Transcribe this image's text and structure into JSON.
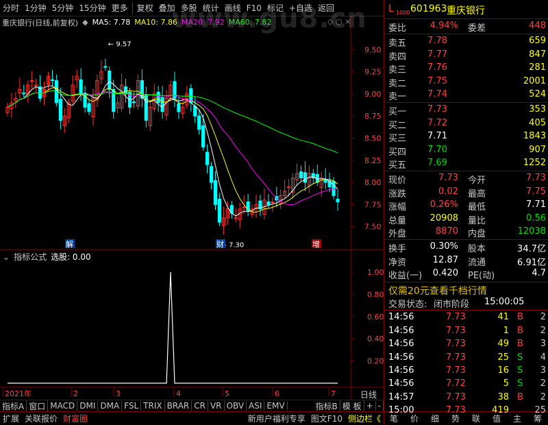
{
  "toolbar": {
    "items": [
      "分时",
      "1分钟",
      "5分钟",
      "15分钟",
      "更多",
      "复权",
      "叠加",
      "多股",
      "统计",
      "画线",
      "F10",
      "标记",
      "+自选",
      "返回"
    ]
  },
  "stock": {
    "prefix": "L",
    "prefix_sub": "1000",
    "code": "601963",
    "name": "重庆银行"
  },
  "chart_header": {
    "name": "重庆银行(日线,前复权)",
    "ma5": "MA5: 7.78",
    "ma10": "MA10: 7.86",
    "ma20": "MA20: 7.92",
    "ma60": "MA60: 7.82"
  },
  "watermark": "www.gu8.cn",
  "chart_data": [
    {
      "type": "candlestick",
      "title": "重庆银行(日线,前复权)",
      "y_ticks": [
        9.5,
        9.25,
        9.0,
        8.75,
        8.5,
        8.25,
        8.0,
        7.75,
        7.5
      ],
      "ylim": [
        7.28,
        9.72
      ],
      "annotations": {
        "high": "9.57",
        "low": "7.30"
      },
      "event_labels": [
        "解",
        "财",
        "增"
      ],
      "x_ticks": [
        "2021年",
        "2",
        "3",
        "4",
        "5",
        "6",
        "7"
      ],
      "series_closes": [
        8.85,
        8.9,
        8.95,
        9.05,
        9.0,
        9.1,
        9.15,
        9.1,
        8.95,
        9.05,
        9.2,
        9.15,
        8.9,
        8.7,
        8.75,
        8.9,
        9.1,
        9.2,
        9.0,
        8.85,
        8.8,
        8.95,
        9.15,
        9.25,
        9.3,
        9.05,
        8.8,
        8.9,
        9.1,
        9.0,
        8.85,
        8.9,
        9.15,
        8.95,
        8.7,
        8.85,
        9.0,
        8.9,
        8.8,
        8.95,
        9.1,
        8.95,
        8.8,
        8.85,
        9.0,
        8.9,
        8.75,
        8.6,
        8.4,
        8.2,
        8.0,
        7.75,
        7.55,
        7.6,
        7.7,
        7.65,
        7.6,
        7.7,
        7.72,
        7.68,
        7.7,
        7.75,
        7.7,
        7.8,
        7.75,
        7.78,
        7.8,
        7.85,
        7.9,
        7.95,
        8.05,
        8.1,
        8.05,
        8.0,
        8.1,
        8.05,
        8.0,
        8.05,
        8.0,
        7.95,
        7.85,
        7.78
      ]
    },
    {
      "type": "line",
      "title": "指标公式 选股: 0.00",
      "y_ticks": [
        1.0,
        0.8,
        0.6,
        0.4,
        0.2
      ],
      "ylim": [
        0,
        1.08
      ],
      "spike_index": 40,
      "spike_value": 1.0
    }
  ],
  "indicator_panel": {
    "label": "指标公式",
    "value": "选股: 0.00",
    "axis_label": "日线"
  },
  "indicator_tabs": [
    "指标A",
    "窗口",
    "MACD",
    "DMI",
    "DMA",
    "FSL",
    "TRIX",
    "BRAR",
    "CR",
    "VR",
    "OBV",
    "ASI",
    "EMV"
  ],
  "indicator_tabs_right": [
    "指标B",
    "模 板",
    "+",
    "-"
  ],
  "bottom_bar": {
    "left": [
      "扩展",
      "关联报价",
      "财富圈"
    ],
    "right": [
      "新用户福利专享",
      "图文F10",
      "侧边栏《"
    ],
    "tabs": [
      "笔",
      "价",
      "细",
      "势",
      "联",
      "值",
      "主",
      "筹"
    ]
  },
  "quote": {
    "weibi_label": "委比",
    "weibi": "4.94%",
    "weicha_label": "委差",
    "weicha": "448",
    "sells": [
      {
        "label": "卖五",
        "price": "7.78",
        "vol": "659"
      },
      {
        "label": "卖四",
        "price": "7.77",
        "vol": "847"
      },
      {
        "label": "卖三",
        "price": "7.76",
        "vol": "281"
      },
      {
        "label": "卖二",
        "price": "7.75",
        "vol": "2001"
      },
      {
        "label": "卖一",
        "price": "7.74",
        "vol": "524"
      }
    ],
    "buys": [
      {
        "label": "买一",
        "price": "7.73",
        "vol": "353"
      },
      {
        "label": "买二",
        "price": "7.72",
        "vol": "405"
      },
      {
        "label": "买三",
        "price": "7.71",
        "vol": "1843"
      },
      {
        "label": "买四",
        "price": "7.70",
        "vol": "907"
      },
      {
        "label": "买五",
        "price": "7.69",
        "vol": "1252"
      }
    ],
    "stats": [
      {
        "l1": "现价",
        "v1": "7.73",
        "l2": "今开",
        "v2": "7.73"
      },
      {
        "l1": "涨跌",
        "v1": "0.02",
        "l2": "最高",
        "v2": "7.75"
      },
      {
        "l1": "涨幅",
        "v1": "0.26%",
        "l2": "最低",
        "v2": "7.71"
      },
      {
        "l1": "总量",
        "v1": "20908",
        "l2": "量比",
        "v2": "0.56"
      },
      {
        "l1": "外盘",
        "v1": "8870",
        "l2": "内盘",
        "v2": "12038"
      }
    ],
    "fund": [
      {
        "l1": "换手",
        "v1": "0.30%",
        "l2": "股本",
        "v2": "34.7亿"
      },
      {
        "l1": "净资",
        "v1": "12.87",
        "l2": "流通",
        "v2": "6.91亿"
      },
      {
        "l1": "收益(一)",
        "v1": "0.420",
        "l2": "PE(动)",
        "v2": "4.7"
      }
    ],
    "promo": "仅需20元查看千档行情",
    "status_label": "交易状态:",
    "status": "闭市阶段",
    "status_time": "15:00:05",
    "ticks": [
      {
        "t": "14:56",
        "p": "7.73",
        "v": "41",
        "s": "B",
        "n": "2"
      },
      {
        "t": "14:56",
        "p": "7.73",
        "v": "1",
        "s": "B",
        "n": "2"
      },
      {
        "t": "14:56",
        "p": "7.73",
        "v": "49",
        "s": "B",
        "n": "3"
      },
      {
        "t": "14:56",
        "p": "7.73",
        "v": "25",
        "s": "S",
        "n": "4"
      },
      {
        "t": "14:56",
        "p": "7.73",
        "v": "16",
        "s": "S",
        "n": "3"
      },
      {
        "t": "14:56",
        "p": "7.72",
        "v": "5",
        "s": "S",
        "n": "2"
      },
      {
        "t": "14:57",
        "p": "7.73",
        "v": "38",
        "s": "B",
        "n": "2"
      },
      {
        "t": "15:00",
        "p": "7.73",
        "v": "419",
        "s": "",
        "n": "25"
      }
    ]
  },
  "colors": {
    "up": "#ff3232",
    "down": "#00ffff",
    "axis": "#800000",
    "ma5": "#ffffff",
    "ma10": "#ffff00",
    "ma20": "#ff00ff",
    "ma60": "#00ff00"
  }
}
